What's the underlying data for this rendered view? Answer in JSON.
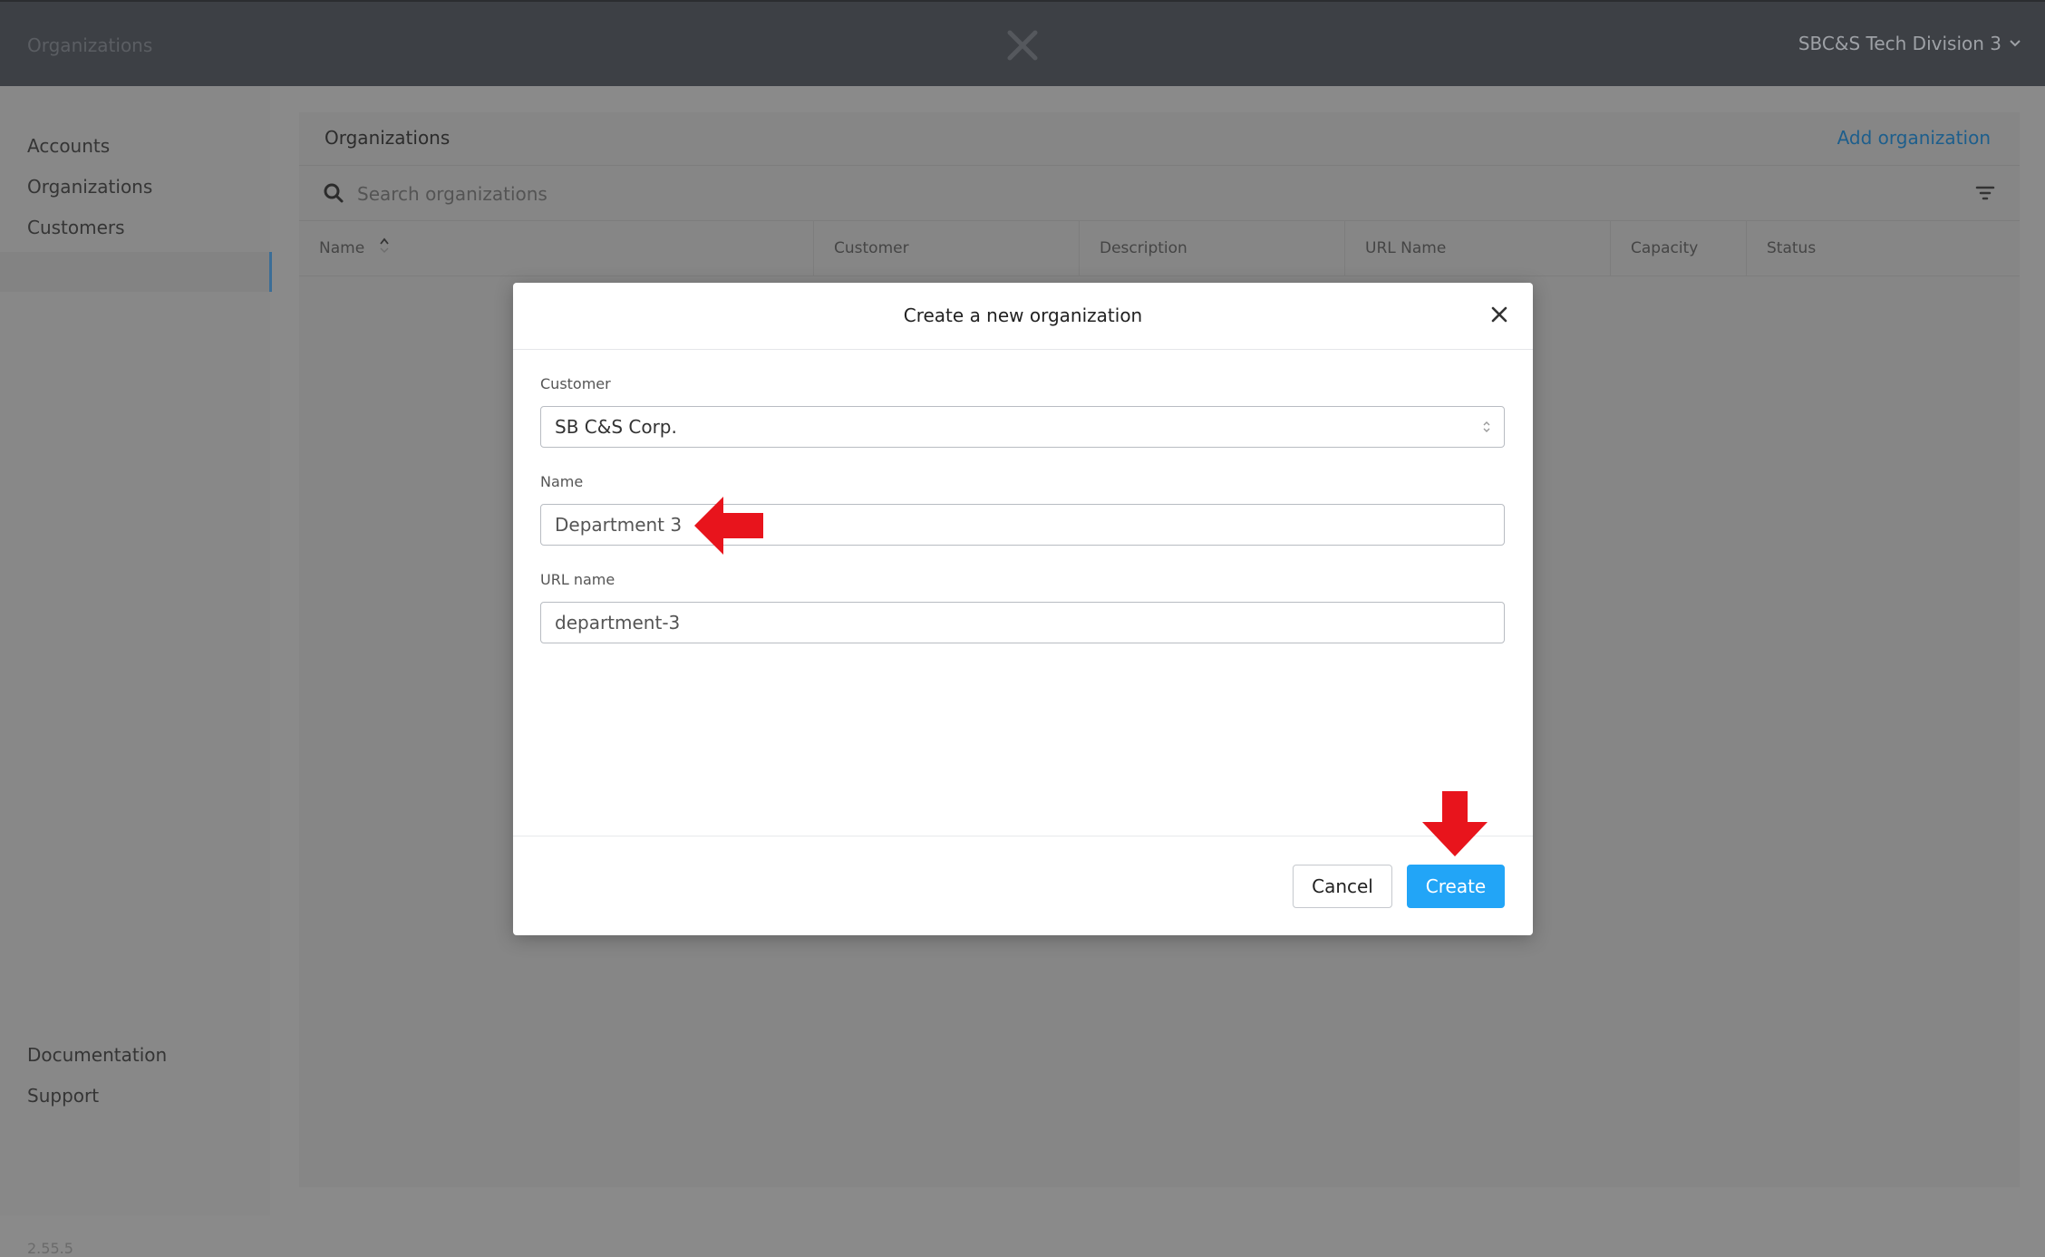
{
  "topbar": {
    "title": "Organizations",
    "account": "SBC&S Tech Division 3"
  },
  "sidebar": {
    "items": [
      {
        "label": "Accounts"
      },
      {
        "label": "Organizations",
        "active": true
      },
      {
        "label": "Customers"
      }
    ],
    "bottom": [
      {
        "label": "Documentation"
      },
      {
        "label": "Support"
      }
    ],
    "version": "2.55.5"
  },
  "content": {
    "title": "Organizations",
    "add_label": "Add organization",
    "search_placeholder": "Search organizations",
    "columns": [
      "Name",
      "Customer",
      "Description",
      "URL Name",
      "Capacity",
      "Status"
    ]
  },
  "modal": {
    "title": "Create a new organization",
    "customer_label": "Customer",
    "customer_value": "SB C&S Corp.",
    "name_label": "Name",
    "name_value": "Department 3",
    "url_label": "URL name",
    "url_value": "department-3",
    "cancel_label": "Cancel",
    "create_label": "Create"
  },
  "colors": {
    "accent": "#22a5f7",
    "annotation_arrow": "#e8141c",
    "topbar": "#3d4045"
  }
}
